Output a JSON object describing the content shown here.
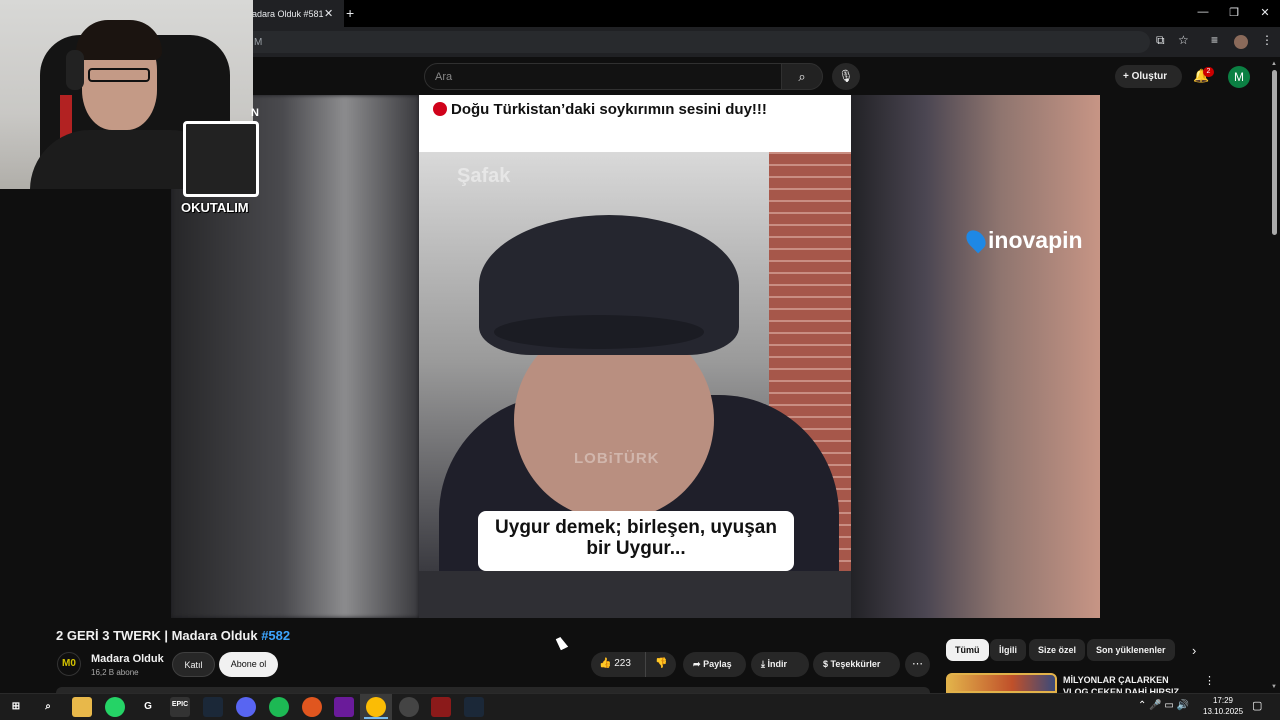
{
  "browser": {
    "tab_title": "adara Olduk #581",
    "tab_close": "✕",
    "new_tab": "+",
    "window_controls": [
      "—",
      "❐",
      "✕"
    ],
    "url_fragment": "M"
  },
  "youtube_header": {
    "search_placeholder": "Ara",
    "search_icon": "⌕",
    "mic_icon": "🎙",
    "create_label": "+ Oluştur",
    "notification_count": "2",
    "avatar_letter": "M"
  },
  "video": {
    "headline": "Doğu Türkistan’daki soykırımın sesini duy!!!",
    "caption_line1": "Uygur demek; birleşen, uyuşan",
    "caption_line2": "bir Uygur...",
    "watermark_center": "LOBiTÜRK",
    "watermark_topleft": "Şafak",
    "sponsor": "inovapin",
    "channel_logo": "M0"
  },
  "webcam": {
    "label": "OKUTALIM",
    "label_partial": "N"
  },
  "details": {
    "title_main": "2 GERİ 3 TWERK | Madara Olduk ",
    "title_tag": "#582",
    "channel_name": "Madara Olduk",
    "subscribers": "16,2 B abone",
    "join_label": "Katıl",
    "subscribe_label": "Abone ol",
    "like_count": "223",
    "share_label": "Paylaş",
    "download_label": "İndir",
    "thanks_label": "Teşekkürler",
    "more_label": "⋯"
  },
  "related": {
    "chips": [
      "Tümü",
      "İlgili",
      "Size özel",
      "Son yüklenenler"
    ],
    "first_title": "MİLYONLAR ÇALARKEN VLOG ÇEKEN DAHİ HIRSIZ"
  },
  "taskbar": {
    "time": "17:29",
    "date": "13.10.2025",
    "icons": [
      "windows-start",
      "search",
      "file-explorer",
      "whatsapp",
      "g-hub",
      "epic-games",
      "steam",
      "discord",
      "spotify",
      "app-orange",
      "app-purple",
      "chrome",
      "app-red",
      "app-game",
      "steam-2"
    ]
  }
}
